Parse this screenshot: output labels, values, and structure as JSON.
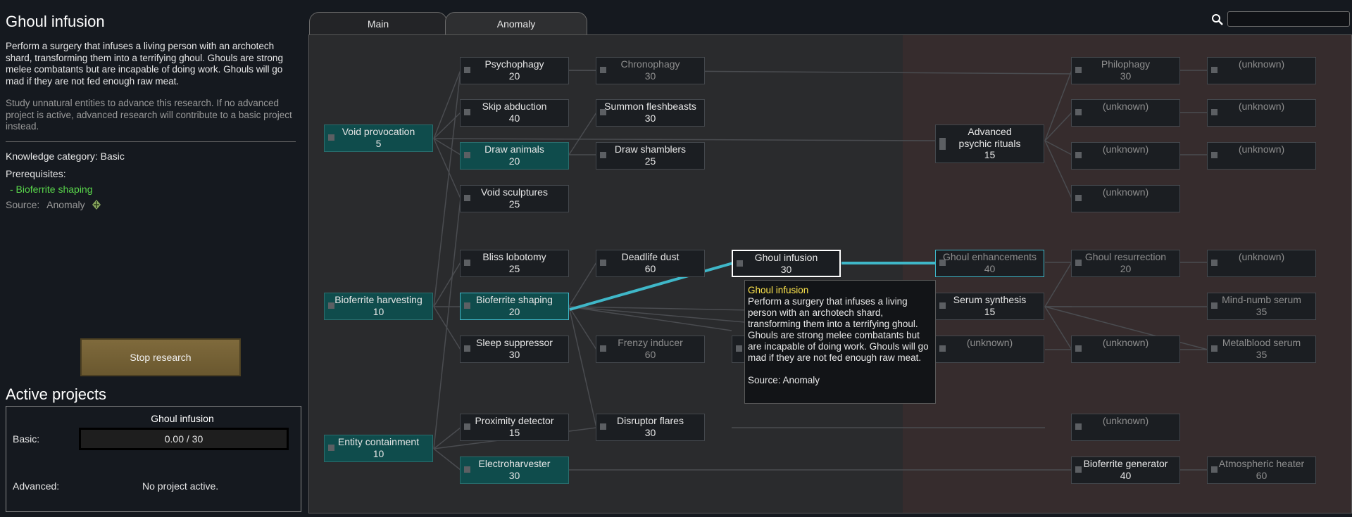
{
  "detail": {
    "title": "Ghoul infusion",
    "description": "Perform a surgery that infuses a living person with an archotech shard, transforming them into a terrifying ghoul. Ghouls are strong melee combatants but are incapable of doing work. Ghouls will go mad if they are not fed enough raw meat.",
    "note": "Study unnatural entities to advance this research. If no advanced project is active, advanced research will contribute to a basic project instead.",
    "knowledge_category": "Knowledge category: Basic",
    "prerequisites_label": "Prerequisites:",
    "prerequisite": " - Bioferrite shaping",
    "source_label": "Source:",
    "source_value": "Anomaly"
  },
  "stop_button": "Stop research",
  "active": {
    "title": "Active projects",
    "project_name": "Ghoul infusion",
    "basic_label": "Basic:",
    "basic_progress": "0.00 / 30",
    "advanced_label": "Advanced:",
    "advanced_value": "No project active."
  },
  "tabs": {
    "main": "Main",
    "anomaly": "Anomaly"
  },
  "search": {
    "placeholder": ""
  },
  "nodes": {
    "void_provocation": {
      "name": "Void provocation",
      "cost": "5"
    },
    "bioferrite_harvesting": {
      "name": "Bioferrite harvesting",
      "cost": "10"
    },
    "entity_containment": {
      "name": "Entity containment",
      "cost": "10"
    },
    "psychophagy": {
      "name": "Psychophagy",
      "cost": "20"
    },
    "skip_abduction": {
      "name": "Skip abduction",
      "cost": "40"
    },
    "draw_animals": {
      "name": "Draw animals",
      "cost": "20"
    },
    "void_sculptures": {
      "name": "Void sculptures",
      "cost": "25"
    },
    "bliss_lobotomy": {
      "name": "Bliss lobotomy",
      "cost": "25"
    },
    "bioferrite_shaping": {
      "name": "Bioferrite shaping",
      "cost": "20"
    },
    "sleep_suppressor": {
      "name": "Sleep suppressor",
      "cost": "30"
    },
    "proximity_detector": {
      "name": "Proximity detector",
      "cost": "15"
    },
    "electroharvester": {
      "name": "Electroharvester",
      "cost": "30"
    },
    "chronophagy": {
      "name": "Chronophagy",
      "cost": "30"
    },
    "summon_fleshbeasts": {
      "name": "Summon fleshbeasts",
      "cost": "30"
    },
    "draw_shamblers": {
      "name": "Draw shamblers",
      "cost": "25"
    },
    "deadlife_dust": {
      "name": "Deadlife dust",
      "cost": "60"
    },
    "frenzy_inducer": {
      "name": "Frenzy inducer",
      "cost": "60"
    },
    "disruptor_flares": {
      "name": "Disruptor flares",
      "cost": "30"
    },
    "ghoul_infusion": {
      "name": "Ghoul infusion",
      "cost": "30"
    },
    "advanced_psychic": {
      "name": "Advanced psychic rituals",
      "cost": "15"
    },
    "ghoul_enhancements": {
      "name": "Ghoul enhancements",
      "cost": "40"
    },
    "serum_synthesis": {
      "name": "Serum synthesis",
      "cost": "15"
    },
    "unknown_mid": {
      "name": "(unknown)",
      "cost": ""
    },
    "philophagy": {
      "name": "Philophagy",
      "cost": "30"
    },
    "unknown_c1": {
      "name": "(unknown)",
      "cost": ""
    },
    "unknown_c2": {
      "name": "(unknown)",
      "cost": ""
    },
    "unknown_c3": {
      "name": "(unknown)",
      "cost": ""
    },
    "ghoul_resurrection": {
      "name": "Ghoul resurrection",
      "cost": "20"
    },
    "unknown_c4": {
      "name": "(unknown)",
      "cost": ""
    },
    "unknown_c5": {
      "name": "(unknown)",
      "cost": ""
    },
    "bioferrite_generator": {
      "name": "Bioferrite generator",
      "cost": "40"
    },
    "unknown_d1": {
      "name": "(unknown)",
      "cost": ""
    },
    "unknown_d2": {
      "name": "(unknown)",
      "cost": ""
    },
    "unknown_d3": {
      "name": "(unknown)",
      "cost": ""
    },
    "unknown_d4": {
      "name": "(unknown)",
      "cost": ""
    },
    "mind_numb_serum": {
      "name": "Mind-numb serum",
      "cost": "35"
    },
    "metalblood_serum": {
      "name": "Metalblood serum",
      "cost": "35"
    },
    "atmospheric_heater": {
      "name": "Atmospheric heater",
      "cost": "60"
    }
  },
  "tooltip": {
    "title": "Ghoul infusion",
    "body": "Perform a surgery that infuses a living person with an archotech shard, transforming them into a terrifying ghoul. Ghouls are strong melee combatants but are incapable of doing work. Ghouls will go mad if they are not fed enough raw meat.",
    "source": "Source: Anomaly"
  },
  "colors": {
    "completed": "#0f4c4c",
    "selected_link": "#3fb7c8",
    "prerequisite": "#59d64b",
    "button": "#7f6a3c"
  }
}
